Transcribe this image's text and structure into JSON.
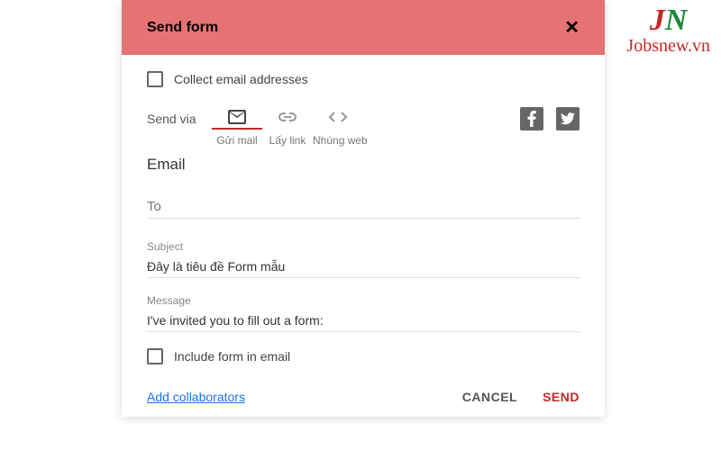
{
  "header": {
    "title": "Send form",
    "close": "✕"
  },
  "collect": {
    "label": "Collect email addresses"
  },
  "sendvia": {
    "label": "Send via",
    "tabs": [
      {
        "name": "email",
        "caption": "Gửi mail"
      },
      {
        "name": "link",
        "caption": "Lấy link"
      },
      {
        "name": "embed",
        "caption": "Nhúng web"
      }
    ]
  },
  "section": {
    "title": "Email"
  },
  "fields": {
    "to_placeholder": "To",
    "subject_label": "Subject",
    "subject_value": "Đây là tiêu đề Form mẫu",
    "message_label": "Message",
    "message_value": "I've invited you to fill out a form:"
  },
  "include": {
    "label": "Include form in email"
  },
  "footer": {
    "collaborators": "Add collaborators",
    "cancel": "CANCEL",
    "send": "SEND"
  },
  "watermark": {
    "j": "J",
    "n": "N",
    "text": "Jobsnew.vn"
  }
}
